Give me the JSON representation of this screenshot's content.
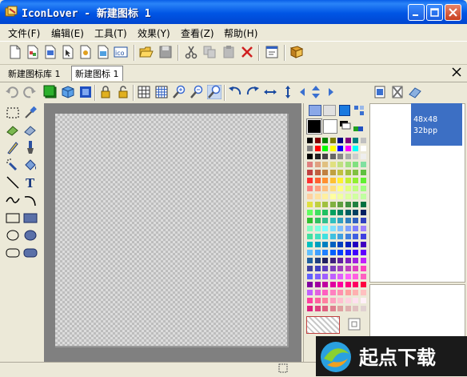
{
  "window": {
    "title": "IconLover - 新建图标 1",
    "minimize": "minimize",
    "maximize": "maximize",
    "close": "close"
  },
  "menu": {
    "items": [
      {
        "label": "文件(F)"
      },
      {
        "label": "编辑(E)"
      },
      {
        "label": "工具(T)"
      },
      {
        "label": "效果(Y)"
      },
      {
        "label": "查看(Z)"
      },
      {
        "label": "帮助(H)"
      }
    ]
  },
  "tabs": [
    {
      "label": "新建图标库 1"
    },
    {
      "label": "新建图标 1"
    }
  ],
  "preview": {
    "size": "48x48",
    "depth": "32bpp"
  },
  "watermark": {
    "text": "起点下载"
  },
  "colors": {
    "titlebar": "#0055e5",
    "selection": "#3c6fc4",
    "window_bg": "#ece9d8"
  }
}
